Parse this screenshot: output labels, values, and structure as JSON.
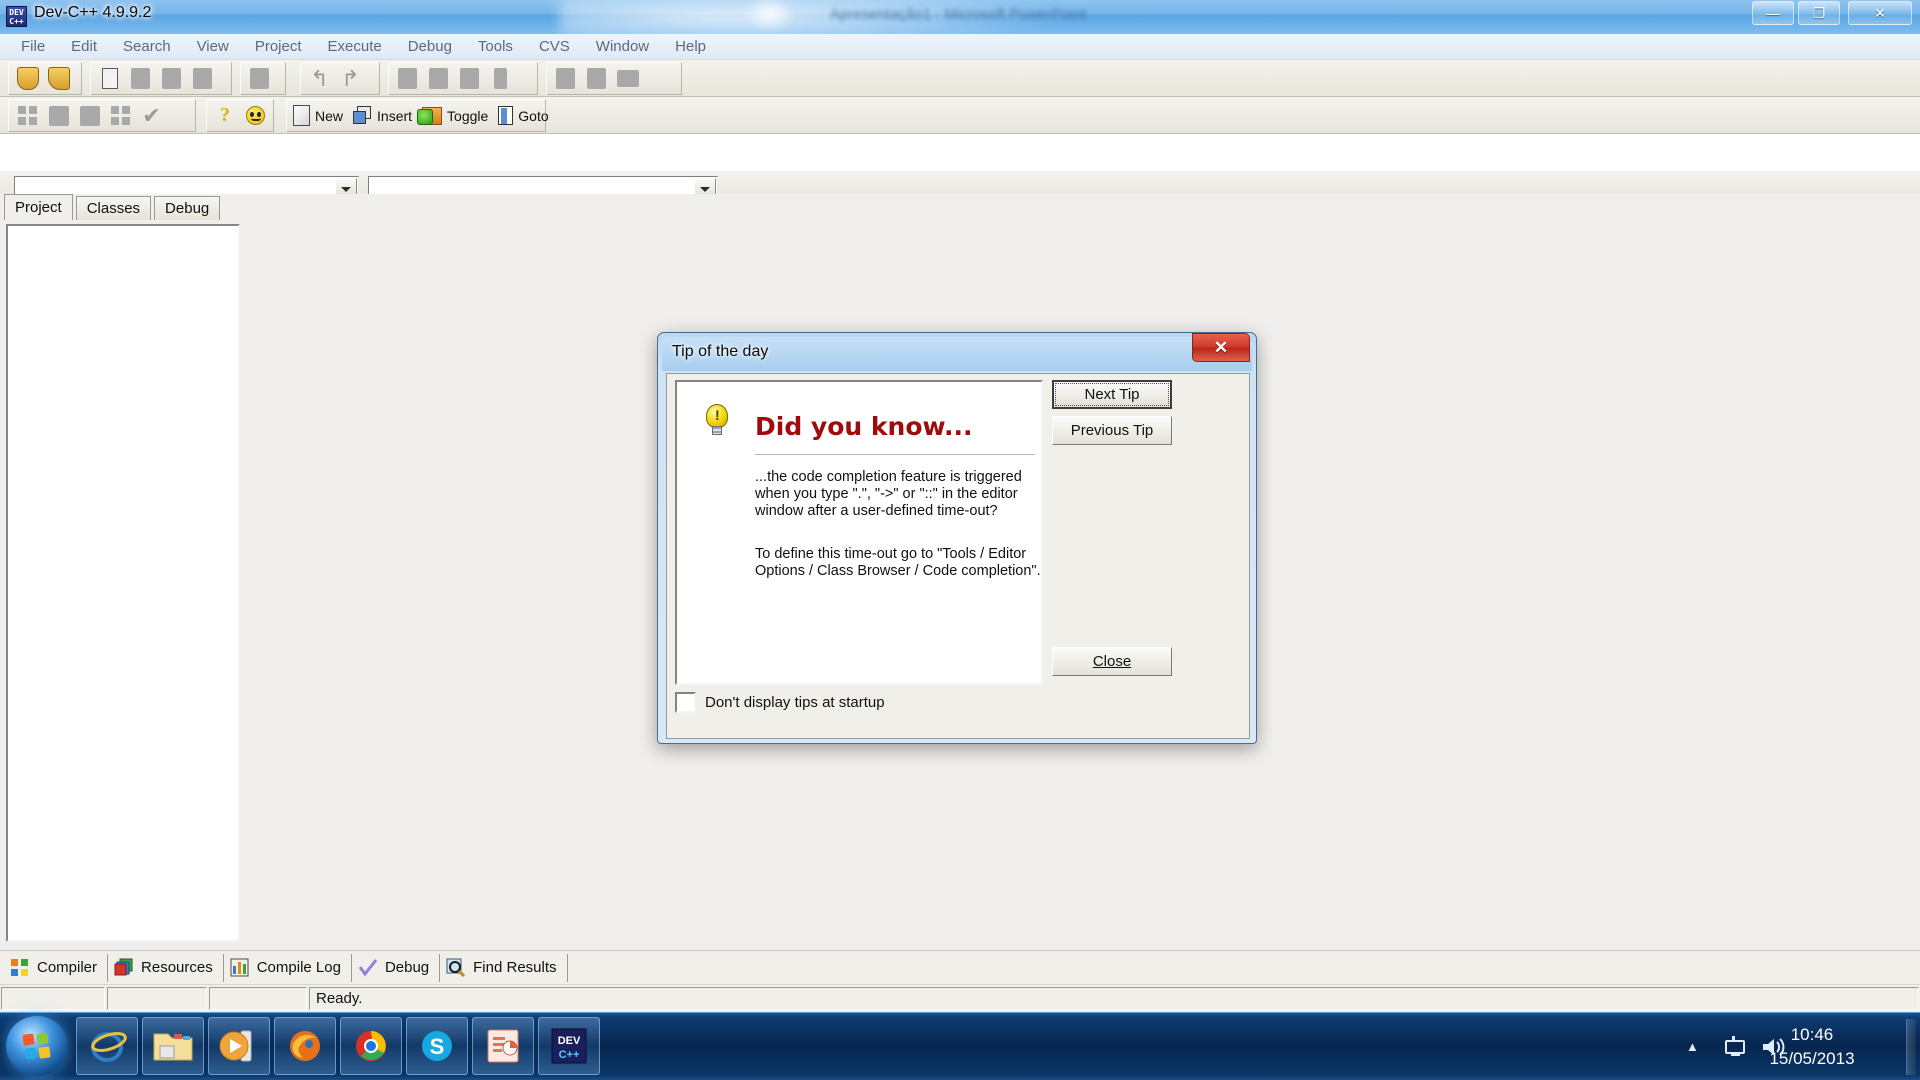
{
  "window": {
    "app_icon": "dev-cpp-icon",
    "title": "Dev-C++ 4.9.9.2",
    "background_window_title": "Apresentação1 - Microsoft PowerPoint",
    "minimize_glyph": "—",
    "maximize_glyph": "❐",
    "close_glyph": "✕"
  },
  "menubar": {
    "items": [
      {
        "label": "File"
      },
      {
        "label": "Edit"
      },
      {
        "label": "Search"
      },
      {
        "label": "View"
      },
      {
        "label": "Project"
      },
      {
        "label": "Execute"
      },
      {
        "label": "Debug"
      },
      {
        "label": "Tools"
      },
      {
        "label": "CVS"
      },
      {
        "label": "Window"
      },
      {
        "label": "Help"
      }
    ]
  },
  "toolbar_main": {
    "groups": [
      {
        "name": "project-group",
        "icons": [
          "new-project-icon",
          "open-project-icon"
        ]
      },
      {
        "name": "file-group",
        "icons": [
          "new-file-icon",
          "open-file-icon",
          "save-file-icon",
          "save-all-icon"
        ]
      },
      {
        "name": "print-group",
        "icons": [
          "print-icon"
        ]
      },
      {
        "name": "undo-group",
        "icons": [
          "undo-icon",
          "redo-icon"
        ]
      },
      {
        "name": "compile-group",
        "icons": [
          "compile-icon",
          "run-icon",
          "compile-run-icon",
          "rebuild-icon"
        ]
      },
      {
        "name": "debug-group",
        "icons": [
          "debug-icon",
          "step-icon",
          "profile-icon"
        ]
      }
    ]
  },
  "toolbar_second": {
    "icons": [
      "tile-icon",
      "maximize-pane-icon",
      "minimize-pane-icon",
      "cascade-icon",
      "check-icon"
    ],
    "help_icons": [
      "help-question-icon",
      "about-smiley-icon"
    ],
    "buttons": [
      {
        "label": "New",
        "icon": "new-page-icon"
      },
      {
        "label": "Insert",
        "icon": "insert-icon"
      },
      {
        "label": "Toggle",
        "icon": "toggle-icon"
      },
      {
        "label": "Goto",
        "icon": "goto-icon"
      }
    ]
  },
  "combos": {
    "combo1_value": "",
    "combo2_value": "",
    "arrow_glyph": "▼"
  },
  "panel_tabs": [
    {
      "label": "Project",
      "active": true
    },
    {
      "label": "Classes",
      "active": false
    },
    {
      "label": "Debug",
      "active": false
    }
  ],
  "bottom_tabs": [
    {
      "label": "Compiler",
      "icon": "compiler-grid-icon"
    },
    {
      "label": "Resources",
      "icon": "resources-layers-icon"
    },
    {
      "label": "Compile Log",
      "icon": "compile-log-chart-icon"
    },
    {
      "label": "Debug",
      "icon": "debug-check-icon"
    },
    {
      "label": "Find Results",
      "icon": "find-results-magnifier-icon"
    }
  ],
  "statusbar": {
    "cell1": "",
    "cell2": "",
    "cell3": "",
    "message": "Ready."
  },
  "tip_dialog": {
    "title": "Tip of the day",
    "close_glyph": "✕",
    "heading": "Did you know...",
    "bulb_icon": "lightbulb-icon",
    "paragraph1": "...the code completion feature is triggered when you type \".\", \"->\" or \"::\" in the editor window after a user-defined time-out?",
    "paragraph2": "To define this time-out go to \"Tools / Editor Options / Class Browser / Code completion\".",
    "next_tip_label": "Next Tip",
    "previous_tip_label": "Previous Tip",
    "close_label": "Close",
    "checkbox_label": "Don't display tips at startup",
    "checkbox_checked": false
  },
  "taskbar": {
    "start_label": "Start",
    "items": [
      {
        "name": "internet-explorer-icon",
        "label": "Internet Explorer"
      },
      {
        "name": "windows-explorer-icon",
        "label": "Windows Explorer"
      },
      {
        "name": "media-player-icon",
        "label": "Windows Media Player"
      },
      {
        "name": "firefox-icon",
        "label": "Mozilla Firefox"
      },
      {
        "name": "chrome-icon",
        "label": "Google Chrome"
      },
      {
        "name": "skype-icon",
        "label": "Skype"
      },
      {
        "name": "powerpoint-icon",
        "label": "Microsoft PowerPoint"
      },
      {
        "name": "dev-cpp-icon",
        "label": "Dev-C++"
      }
    ],
    "tray": {
      "expand_glyph": "▲",
      "network_icon": "network-icon",
      "volume_icon": "volume-icon",
      "time": "10:46",
      "date": "15/05/2013"
    }
  },
  "colors": {
    "accent_blue": "#4a90d9",
    "dialog_red": "#a00a0a",
    "close_red": "#d03a29",
    "toolbar_bg": "#ece9d8"
  }
}
